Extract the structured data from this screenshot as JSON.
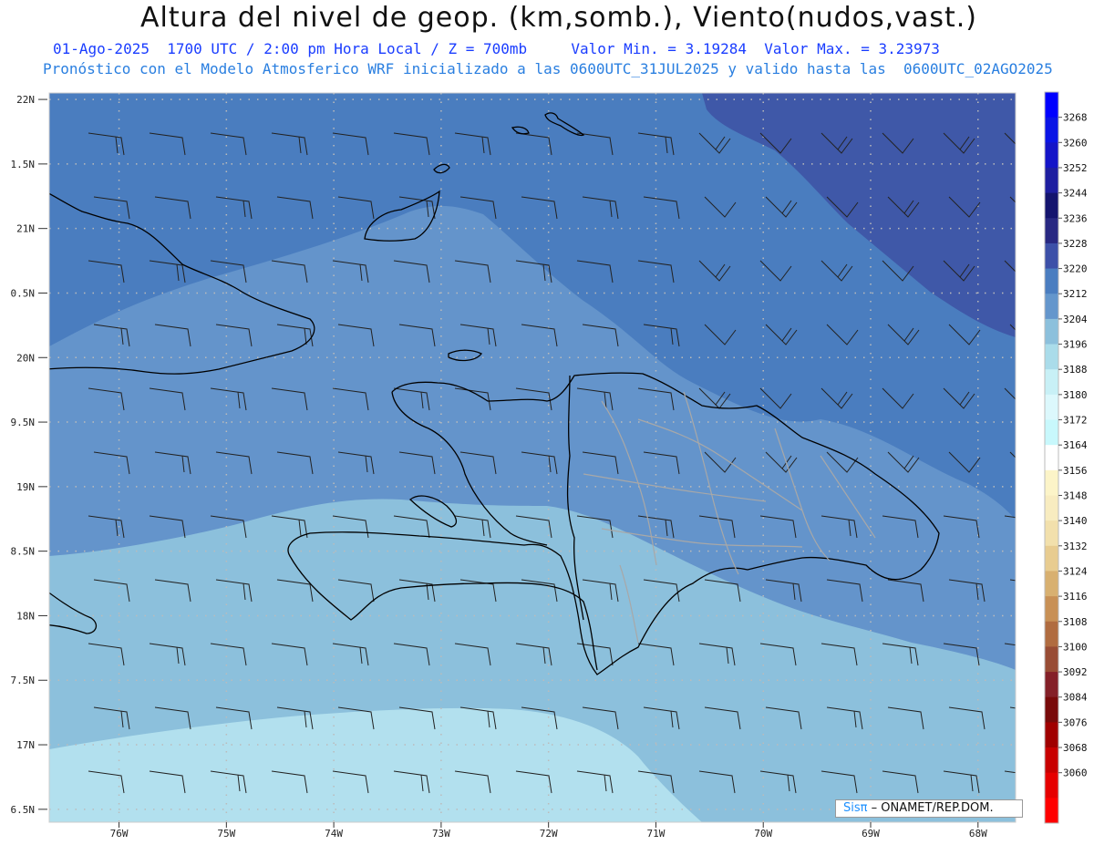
{
  "title": "Altura del nivel de geop. (km,somb.), Viento(nudos,vast.)",
  "subtitle_date": "01-Ago-2025  1700 UTC / 2:00 pm Hora Local / Z = 700mb",
  "subtitle_minmax": "Valor Min. = 3.19284  Valor Max. = 3.23973",
  "subtitle_model": "Pronóstico con el Modelo Atmosferico WRF inicializado a las 0600UTC_31JUL2025 y valido hasta las  0600UTC_02AGO2025",
  "credit": {
    "brand": "Sisπ",
    "text": " – ONAMET/REP.DOM."
  },
  "map": {
    "lat_labels": [
      "22N",
      "1.5N",
      "21N",
      "0.5N",
      "20N",
      "9.5N",
      "19N",
      "8.5N",
      "18N",
      "7.5N",
      "17N",
      "6.5N"
    ],
    "lat_values": [
      22,
      21.5,
      21,
      20.5,
      20,
      19.5,
      19,
      18.5,
      18,
      17.5,
      17,
      16.5
    ],
    "lon_labels": [
      "76W",
      "75W",
      "74W",
      "73W",
      "72W",
      "71W",
      "70W",
      "69W",
      "68W"
    ],
    "lon_values": [
      -76,
      -75,
      -74,
      -73,
      -72,
      -71,
      -70,
      -69,
      -68
    ],
    "lat_range": [
      16.4,
      22.05
    ],
    "lon_range": [
      -76.65,
      -67.65
    ]
  },
  "colorbar": {
    "labels": [
      "3268",
      "3260",
      "3252",
      "3244",
      "3236",
      "3228",
      "3220",
      "3212",
      "3204",
      "3196",
      "3188",
      "3180",
      "3172",
      "3164",
      "3156",
      "3148",
      "3140",
      "3132",
      "3124",
      "3116",
      "3108",
      "3100",
      "3092",
      "3084",
      "3076",
      "3068",
      "3060"
    ],
    "colors": [
      "#0000ff",
      "#0a14e6",
      "#1414c8",
      "#1e1ea0",
      "#14146e",
      "#282882",
      "#3c50a8",
      "#4a7dc0",
      "#6496cc",
      "#8cc0dc",
      "#aadcea",
      "#c8f0f6",
      "#dcf8fc",
      "#c8f8fc",
      "#ffffff",
      "#fcf4c8",
      "#f8ecc0",
      "#f2e0ac",
      "#e8cc90",
      "#d8b070",
      "#c89055",
      "#b06c40",
      "#984c34",
      "#842028",
      "#780a0a",
      "#a00000",
      "#c80000",
      "#e60000",
      "#ff0000"
    ]
  },
  "field_colors": {
    "c3228": "#3f58a8",
    "c3220": "#4a7dbf",
    "c3212": "#6494cb",
    "c3204": "#8cc0dc",
    "c3196": "#b2e0ee"
  },
  "line_colors": {
    "coast": "#000000",
    "border": "#a8a8a8",
    "grid": "#bbbbbb",
    "barb": "#222222"
  }
}
